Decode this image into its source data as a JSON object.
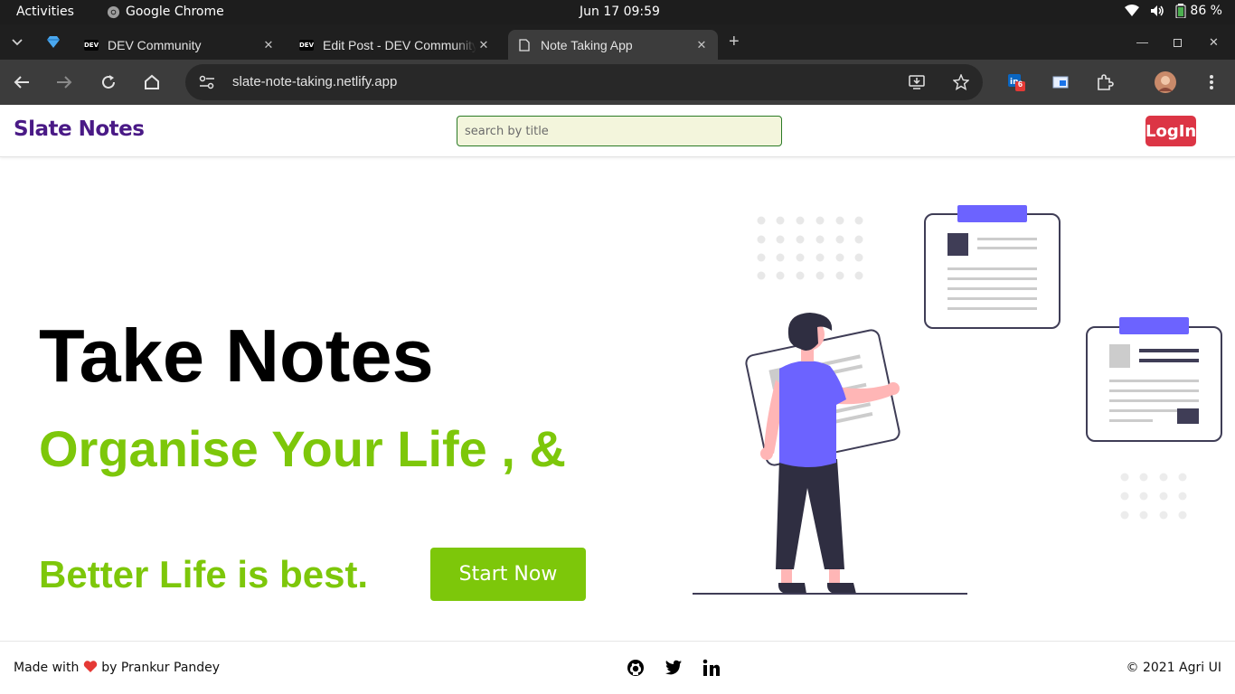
{
  "system": {
    "activities": "Activities",
    "app_name": "Google Chrome",
    "clock": "Jun 17  09:59",
    "battery": "86 %"
  },
  "tabs": [
    {
      "title": "DEV Community",
      "active": false
    },
    {
      "title": "Edit Post - DEV Community",
      "active": false
    },
    {
      "title": "Note Taking App",
      "active": true
    }
  ],
  "toolbar": {
    "url": "slate-note-taking.netlify.app",
    "extension_badge": "6"
  },
  "navbar": {
    "brand": "Slate Notes",
    "search_placeholder": "search by title",
    "login_label": "LogIn"
  },
  "hero": {
    "title": "Take Notes",
    "subtitle_line1": "Organise Your Life , &",
    "subtitle_line2": "Better Life is best.",
    "cta_label": "Start Now"
  },
  "footer": {
    "made_prefix": "Made with",
    "made_suffix": "by Prankur Pandey",
    "social": [
      "github-icon",
      "twitter-icon",
      "linkedin-icon"
    ],
    "copyright": "© 2021 Agri UI"
  },
  "colors": {
    "brand": "#4a1a86",
    "accent_green": "#7dc70a",
    "login_red": "#dc3545",
    "illustration_purple": "#6c63ff"
  }
}
